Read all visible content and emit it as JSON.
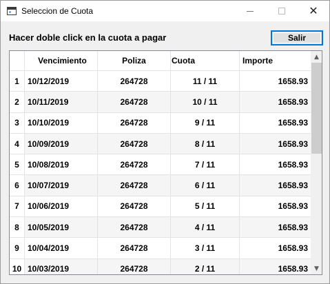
{
  "window": {
    "title": "Seleccion de Cuota",
    "close_glyph": "✕"
  },
  "toolbar": {
    "instruction": "Hacer doble click en la cuota a pagar",
    "salir_label": "Salir"
  },
  "table": {
    "columns": [
      "",
      "Vencimiento",
      "Poliza",
      "Cuota",
      "Importe"
    ],
    "rows": [
      {
        "n": "1",
        "vencimiento": "10/12/2019",
        "poliza": "264728",
        "cuota": "11 / 11",
        "importe": "1658.93"
      },
      {
        "n": "2",
        "vencimiento": "10/11/2019",
        "poliza": "264728",
        "cuota": "10 / 11",
        "importe": "1658.93"
      },
      {
        "n": "3",
        "vencimiento": "10/10/2019",
        "poliza": "264728",
        "cuota": "9 / 11",
        "importe": "1658.93"
      },
      {
        "n": "4",
        "vencimiento": "10/09/2019",
        "poliza": "264728",
        "cuota": "8 / 11",
        "importe": "1658.93"
      },
      {
        "n": "5",
        "vencimiento": "10/08/2019",
        "poliza": "264728",
        "cuota": "7 / 11",
        "importe": "1658.93"
      },
      {
        "n": "6",
        "vencimiento": "10/07/2019",
        "poliza": "264728",
        "cuota": "6 / 11",
        "importe": "1658.93"
      },
      {
        "n": "7",
        "vencimiento": "10/06/2019",
        "poliza": "264728",
        "cuota": "5 / 11",
        "importe": "1658.93"
      },
      {
        "n": "8",
        "vencimiento": "10/05/2019",
        "poliza": "264728",
        "cuota": "4 / 11",
        "importe": "1658.93"
      },
      {
        "n": "9",
        "vencimiento": "10/04/2019",
        "poliza": "264728",
        "cuota": "3 / 11",
        "importe": "1658.93"
      },
      {
        "n": "10",
        "vencimiento": "10/03/2019",
        "poliza": "264728",
        "cuota": "2 / 11",
        "importe": "1658.93"
      }
    ]
  },
  "icons": {
    "app": "app-window-icon",
    "minimize": "minimize-icon",
    "maximize": "maximize-icon",
    "close": "close-icon",
    "scroll_up": "scroll-up-arrow-icon",
    "scroll_down": "scroll-down-arrow-icon"
  },
  "colors": {
    "focus_border": "#0078d7",
    "button_face": "#e1e1e1",
    "alt_row": "#f5f5f5",
    "scroll_thumb": "#cdcdcd"
  }
}
